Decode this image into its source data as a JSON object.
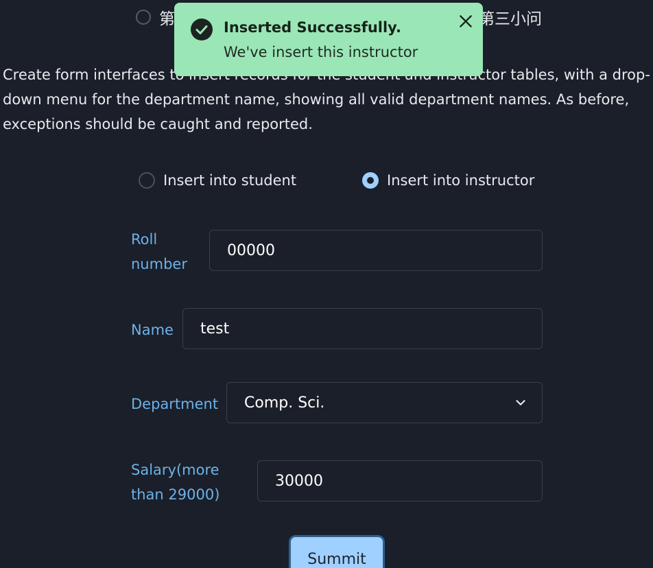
{
  "question_tabs": {
    "first_label": "第",
    "third_label": "第三小问"
  },
  "description": "Create form interfaces to insert records for the student and instructor tables, with a drop-down menu for the department name, showing all valid department names. As before, exceptions should be caught and reported.",
  "mode": {
    "student_label": "Insert into student",
    "instructor_label": "Insert into instructor",
    "selected": "instructor"
  },
  "form": {
    "roll_label_1": "Roll",
    "roll_label_2": "number",
    "roll_value": "00000",
    "name_label": "Name",
    "name_value": "test",
    "department_label": "Department",
    "department_value": "Comp. Sci.",
    "salary_label_1": "Salary(more",
    "salary_label_2": "than 29000)",
    "salary_value": "30000",
    "submit_label": "Summit"
  },
  "toast": {
    "title": "Inserted Successfully.",
    "message": "We've insert this instructor",
    "color": "#9be6b6"
  },
  "colors": {
    "background": "#1b1f29",
    "label": "#6cb2ea",
    "accent": "#9fd0ff"
  }
}
